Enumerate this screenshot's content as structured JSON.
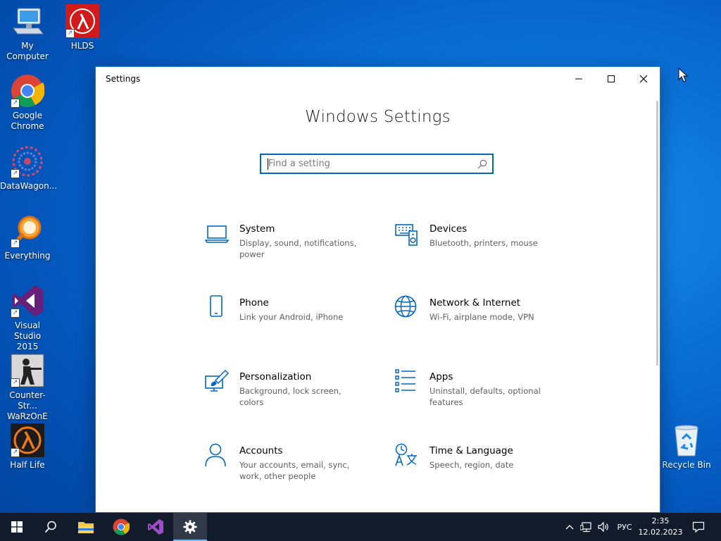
{
  "desktop": {
    "icons": [
      {
        "label": "My Computer"
      },
      {
        "label": "HLDS"
      },
      {
        "label": "Google Chrome"
      },
      {
        "label": "DataWagon..."
      },
      {
        "label": "Everything"
      },
      {
        "label": "Visual Studio 2015"
      },
      {
        "label": "Counter-Str... WaRzOnE"
      },
      {
        "label": "Half Life"
      },
      {
        "label": "Recycle Bin"
      }
    ]
  },
  "window": {
    "title": "Settings",
    "heading": "Windows Settings",
    "search": {
      "placeholder": "Find a setting",
      "value": ""
    },
    "tiles": [
      {
        "title": "System",
        "desc": "Display, sound, notifications, power",
        "icon": "laptop-icon"
      },
      {
        "title": "Devices",
        "desc": "Bluetooth, printers, mouse",
        "icon": "keyboard-speaker-icon"
      },
      {
        "title": "Phone",
        "desc": "Link your Android, iPhone",
        "icon": "phone-icon"
      },
      {
        "title": "Network & Internet",
        "desc": "Wi-Fi, airplane mode, VPN",
        "icon": "globe-icon"
      },
      {
        "title": "Personalization",
        "desc": "Background, lock screen, colors",
        "icon": "paint-brush-icon"
      },
      {
        "title": "Apps",
        "desc": "Uninstall, defaults, optional features",
        "icon": "apps-list-icon"
      },
      {
        "title": "Accounts",
        "desc": "Your accounts, email, sync, work, other people",
        "icon": "person-icon"
      },
      {
        "title": "Time & Language",
        "desc": "Speech, region, date",
        "icon": "time-language-icon"
      }
    ]
  },
  "taskbar": {
    "apps": [
      "start-icon",
      "search-icon",
      "file-explorer-icon",
      "chrome-icon",
      "visual-studio-icon",
      "settings-gear-icon"
    ],
    "language": "РУС",
    "time": "2:35",
    "date": "12.02.2023"
  },
  "colors": {
    "accent": "#0067c0",
    "taskbar": "#121b2b",
    "desktop": "#0a6fd6"
  }
}
